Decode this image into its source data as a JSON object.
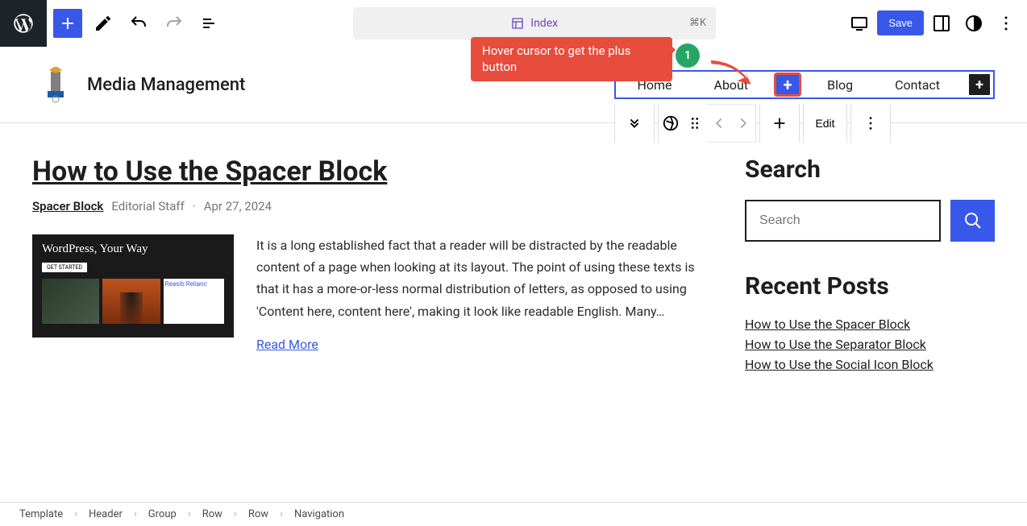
{
  "toolbar": {
    "doc_title": "Index",
    "shortcut": "⌘K",
    "save_label": "Save"
  },
  "annotation": {
    "text": "Hover cursor to get the plus button",
    "badge": "1"
  },
  "site": {
    "title": "Media Management"
  },
  "nav": {
    "items": [
      "Home",
      "About",
      "Blog",
      "Contact"
    ]
  },
  "block_toolbar": {
    "edit_label": "Edit"
  },
  "post": {
    "title": "How to Use the Spacer Block",
    "category": "Spacer Block",
    "author": "Editorial Staff",
    "date": "Apr 27, 2024",
    "thumb_title": "WordPress, Your Way",
    "thumb_btn": "GET STARTED",
    "thumb_tag": "Reasib Relianc",
    "excerpt": "It is a long established fact that a reader will be distracted by the readable content of a page when looking at its layout. The point of using these texts is that it has a more-or-less normal distribution of letters, as opposed to using 'Content here, content here', making it look like readable English. Many…",
    "read_more": "Read More"
  },
  "sidebar": {
    "search_heading": "Search",
    "search_placeholder": "Search",
    "recent_heading": "Recent Posts",
    "recent": [
      "How to Use the Spacer Block",
      "How to Use the Separator Block",
      "How to Use the Social Icon Block"
    ]
  },
  "breadcrumb": [
    "Template",
    "Header",
    "Group",
    "Row",
    "Row",
    "Navigation"
  ]
}
